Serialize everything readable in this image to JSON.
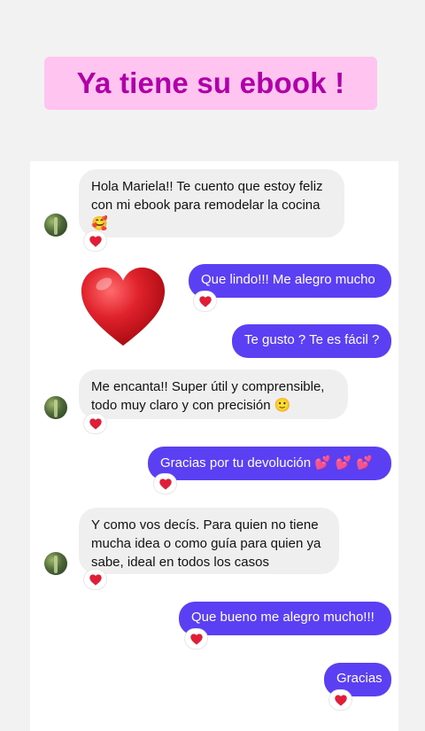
{
  "banner": {
    "title": "Ya tiene su ebook !"
  },
  "colors": {
    "banner_bg": "#ffc4ef",
    "banner_text": "#b000a8",
    "outgoing": "#5b3ff2",
    "incoming": "#efefef",
    "heart": "#e01e37"
  },
  "messages": {
    "m1": {
      "line1": "Hola Mariela!! Te cuento que estoy feliz",
      "line2": "con mi ebook para remodelar la cocina",
      "emoji": "🥰"
    },
    "m2": {
      "text": "Que lindo!!! Me alegro mucho"
    },
    "m3": {
      "text": "Te gusto ? Te es fácil ?"
    },
    "m4": {
      "line1": "Me encanta!! Super útil y comprensible,",
      "line2": "todo muy claro y con precisión",
      "emoji": "🙂"
    },
    "m5": {
      "text": "Gracias por tu devolución",
      "emoji": "💕 💕 💕"
    },
    "m6": {
      "line1": "Y como vos decís. Para quien no tiene",
      "line2": "mucha idea o como guía para quien ya",
      "line3": "sabe, ideal en todos los casos"
    },
    "m7": {
      "text": "Que bueno me alegro mucho!!!"
    },
    "m8": {
      "text": "Gracias"
    }
  },
  "icons": {
    "reaction": "heart-icon",
    "sticker": "big-heart-sticker",
    "avatar": "contact-avatar"
  }
}
